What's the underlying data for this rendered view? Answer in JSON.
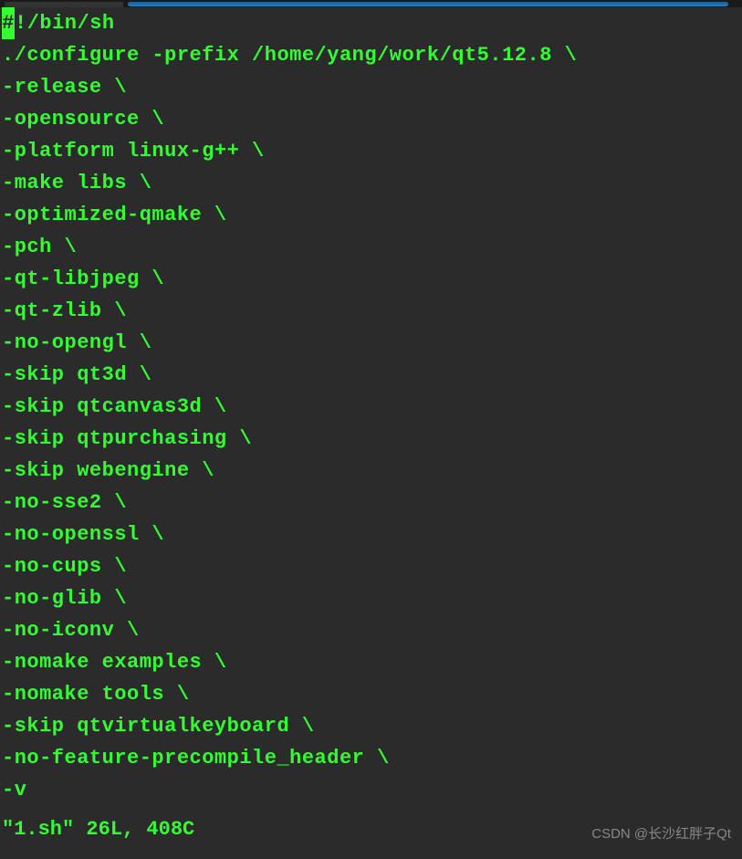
{
  "editor": {
    "cursor_char": "#",
    "lines": [
      "!/bin/sh",
      "./configure -prefix /home/yang/work/qt5.12.8 \\",
      "-release \\",
      "-opensource \\",
      "-platform linux-g++ \\",
      "-make libs \\",
      "-optimized-qmake \\",
      "-pch \\",
      "-qt-libjpeg \\",
      "-qt-zlib \\",
      "-no-opengl \\",
      "-skip qt3d \\",
      "-skip qtcanvas3d \\",
      "-skip qtpurchasing \\",
      "-skip webengine \\",
      "-no-sse2 \\",
      "-no-openssl \\",
      "-no-cups \\",
      "-no-glib \\",
      "-no-iconv \\",
      "-nomake examples \\",
      "-nomake tools \\",
      "-skip qtvirtualkeyboard \\",
      "-no-feature-precompile_header \\",
      "-v"
    ]
  },
  "status": {
    "filename": "\"1.sh\"",
    "info": " 26L, 408C"
  },
  "watermark": "CSDN @长沙红胖子Qt"
}
